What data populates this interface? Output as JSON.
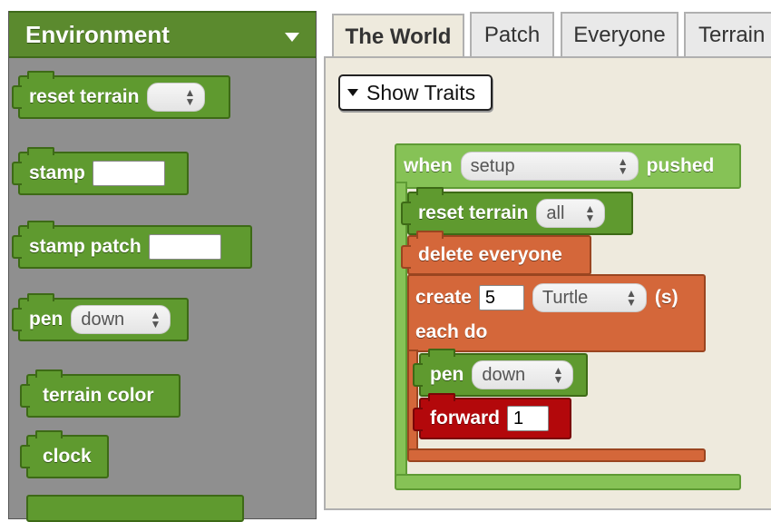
{
  "palette": {
    "title": "Environment",
    "color": "#5b8a2e",
    "toggle_icon": "triangle-down-icon",
    "blocks": {
      "reset_terrain": {
        "label": "reset terrain",
        "selected": ""
      },
      "stamp": {
        "label": "stamp",
        "value": ""
      },
      "stamp_patch": {
        "label": "stamp patch",
        "value": ""
      },
      "pen": {
        "label": "pen",
        "selected": "down"
      },
      "terrain_color": {
        "label": "terrain color"
      },
      "clock": {
        "label": "clock"
      }
    }
  },
  "tabs": [
    {
      "label": "The World",
      "active": true
    },
    {
      "label": "Patch",
      "active": false
    },
    {
      "label": "Everyone",
      "active": false
    },
    {
      "label": "Terrain",
      "active": false
    }
  ],
  "workspace": {
    "show_traits_label": "Show Traits",
    "when_block": {
      "when": "when",
      "event": "setup",
      "pushed": "pushed"
    },
    "reset_terrain": {
      "label": "reset terrain",
      "selected": "all"
    },
    "delete_everyone": {
      "label": "delete everyone"
    },
    "create": {
      "label": "create",
      "count": "5",
      "breed": "Turtle",
      "suffix": "(s)",
      "each_do": "each do"
    },
    "pen": {
      "label": "pen",
      "selected": "down"
    },
    "forward": {
      "label": "forward",
      "value": "1"
    }
  },
  "colors": {
    "green_block": "#5f9a2f",
    "lime_block": "#86c256",
    "orange_block": "#d4673a",
    "red_block": "#b3080b",
    "workspace_bg": "#eeeadd",
    "palette_bg": "#8f8f8f"
  }
}
